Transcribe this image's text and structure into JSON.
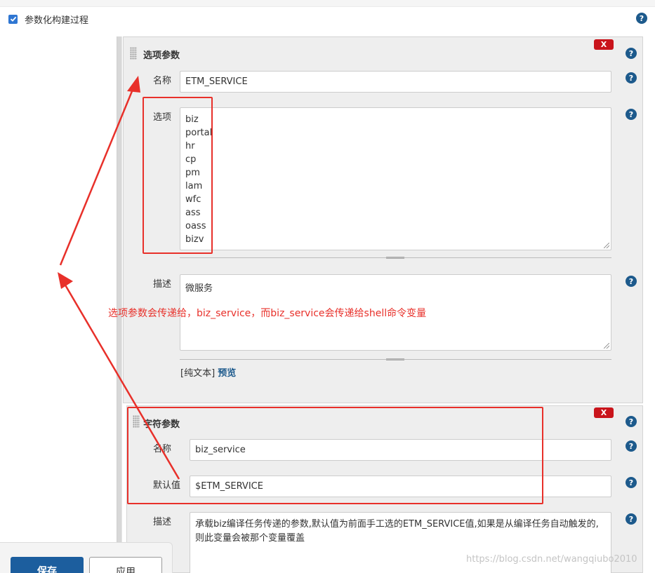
{
  "header": {
    "checkbox_label": "参数化构建过程",
    "checked": true
  },
  "choice_param": {
    "title": "选项参数",
    "delete_label": "X",
    "name_label": "名称",
    "name_value": "ETM_SERVICE",
    "options_label": "选项",
    "options": [
      "biz",
      "portal",
      "hr",
      "cp",
      "pm",
      "lam",
      "wfc",
      "ass",
      "oass",
      "bizv"
    ],
    "desc_label": "描述",
    "desc_value": "微服务",
    "format_plain": "[纯文本]",
    "format_preview": "预览"
  },
  "string_param": {
    "title": "字符参数",
    "delete_label": "X",
    "name_label": "名称",
    "name_value": "biz_service",
    "default_label": "默认值",
    "default_value": "$ETM_SERVICE",
    "desc_label": "描述",
    "desc_value": "承载biz编译任务传递的参数,默认值为前面手工选的ETM_SERVICE值,如果是从编译任务自动触发的,则此变量会被那个变量覆盖"
  },
  "annotation": {
    "text": "选项参数会传递给，biz_service，而biz_service会传递给shell命令变量"
  },
  "buttons": {
    "save": "保存",
    "apply": "应用"
  },
  "help_glyph": "?",
  "watermark": "https://blog.csdn.net/wangqiubo2010",
  "colors": {
    "accent_blue": "#1c5e9e",
    "annotation_red": "#e8302a",
    "delete_red": "#c9141b",
    "help_blue": "#1d5a8c"
  }
}
